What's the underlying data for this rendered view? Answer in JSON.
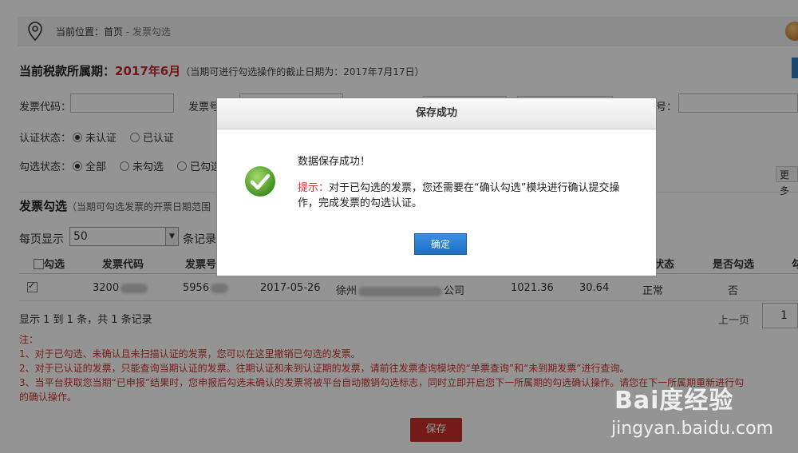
{
  "breadcrumb": {
    "prefix": "当前位置：",
    "home": "首页",
    "sep": " - ",
    "current": "发票勾选"
  },
  "period": {
    "label": "当前税款所属期：",
    "value": "2017年6月",
    "note": "（当期可进行勾选操作的截止日期为：2017年7月17日）"
  },
  "filters": {
    "invoice_code_label": "发票代码：",
    "invoice_no_label": "发票号",
    "tail_label": "号：",
    "auth_status_label": "认证状态：",
    "auth_options": [
      "未认证",
      "已认证"
    ],
    "select_status_label": "勾选状态：",
    "select_options": [
      "全部",
      "未勾选",
      "已勾选"
    ],
    "more_label": "更多"
  },
  "section": {
    "title": "发票勾选",
    "note": "（当期可勾选发票的开票日期范围"
  },
  "paging": {
    "per_page_label": "每页显示",
    "per_page_value": "50",
    "per_page_suffix": "条记录"
  },
  "table": {
    "headers": [
      "勾选",
      "发票代码",
      "发票号",
      "状态",
      "是否勾选",
      "勾"
    ],
    "row": {
      "code": "3200",
      "number": "5956",
      "date": "2017-05-26",
      "seller_prefix": "徐州",
      "seller_suffix": "公司",
      "amount": "1021.36",
      "tax": "30.64",
      "status": "正常",
      "selected": "否"
    }
  },
  "summary": "显示 1 到 1 条，共 1 条记录",
  "pager": {
    "prev": "上一页",
    "page": "1"
  },
  "notes": [
    "注：",
    "1、对于已勾选、未确认且未扫描认证的发票，您可以在这里撤销已勾选的发票。",
    "2、对于已认证的发票，只能查询当期认证的发票。往期认证和未到认证期的发票，请前往发票查询模块的“单票查询”和“未到期发票”进行查询。",
    "3、当平台获取您当期“已申报”结果时，您申报后勾选未确认的发票将被平台自动撤销勾选标志，同时立即开启您下一所属期的勾选确认操作。请您在下一所属期重新进行勾",
    "的确认操作。"
  ],
  "save_button": "保存",
  "dialog": {
    "title": "保存成功",
    "message": "数据保存成功！",
    "hint_label": "提示：",
    "hint_text": "对于已勾选的发票，您还需要在“确认勾选”模块进行确认提交操作，完成发票的勾选认证。",
    "ok_button": "确定"
  },
  "watermark": {
    "brand": "Bai度经验",
    "url": "jingyan.baidu.com"
  },
  "colors": {
    "accent_red": "#c0282d",
    "primary_blue": "#1f6fc3",
    "success_green": "#5aa52c"
  }
}
